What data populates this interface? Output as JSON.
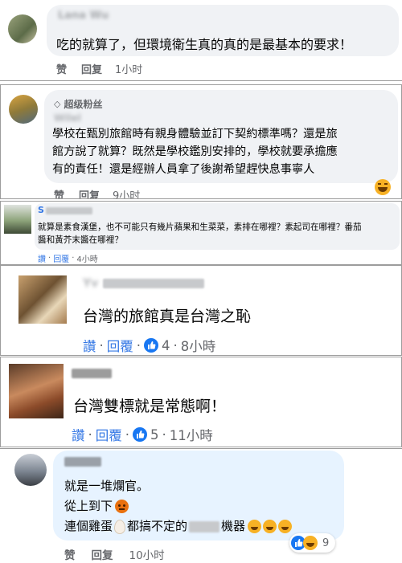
{
  "comments": [
    {
      "author": "Lana Wu",
      "text": "吃的就算了，但環境衛生真的真的是最基本的要求！",
      "actions": {
        "like": "赞",
        "reply": "回复",
        "time": "1小时"
      }
    },
    {
      "badge": "超级粉丝",
      "author": "Wilel",
      "text_lines": [
        "學校在甄別旅館時有親身體驗並訂下契約標準嗎？還是旅",
        "館方說了就算？既然是學校鑑別安排的，學校就要承擔應",
        "有的責任！還是經辦人員拿了後謝希望趕快息事寧人"
      ],
      "actions": {
        "like": "赞",
        "reply": "回复",
        "time": "9小时"
      }
    },
    {
      "author": "S",
      "text_lines": [
        "就算是素食漢堡，也不可能只有幾片蘋果和生菜菜，素排在哪裡？素起司在哪裡？番茄",
        "醬和黃芥末醬在哪裡？"
      ],
      "actions": {
        "like": "讚",
        "sep": "·",
        "reply": "回覆",
        "time": "4小時"
      }
    },
    {
      "author": "Yv",
      "text": "台灣的旅館真是台灣之恥",
      "actions": {
        "like": "讚",
        "sep": "·",
        "reply": "回覆",
        "reactions": "4",
        "time": "8小時"
      }
    },
    {
      "author": "",
      "text": "台灣雙標就是常態啊！",
      "actions": {
        "like": "讚",
        "sep": "·",
        "reply": "回覆",
        "reactions": "5",
        "time": "11小時"
      }
    },
    {
      "author": "",
      "text_lines": [
        "就是一堆爛官。",
        "從上到下",
        "連個雞蛋",
        "都搞不定的",
        "機器"
      ],
      "actions": {
        "like": "赞",
        "reply": "回复",
        "time": "10小时"
      },
      "reaction_count": "9"
    }
  ]
}
